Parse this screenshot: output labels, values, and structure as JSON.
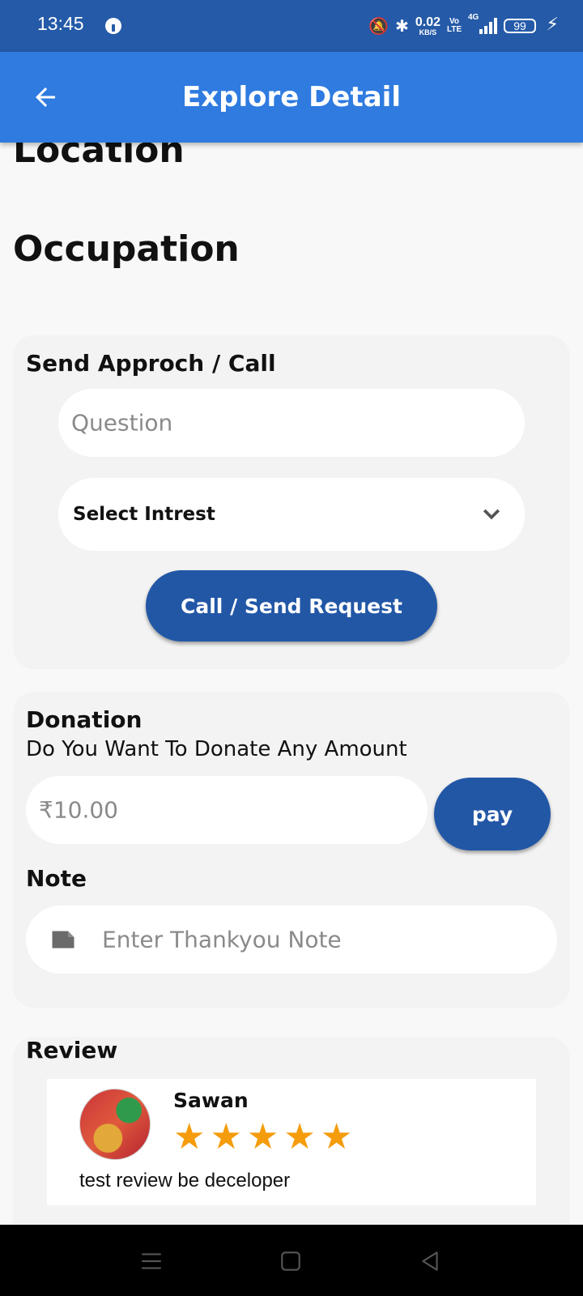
{
  "status_bar": {
    "time": "13:45",
    "net_speed_value": "0.02",
    "net_speed_unit": "KB/S",
    "volte": "Vo LTE",
    "network_type": "4G",
    "battery": "99"
  },
  "app_bar": {
    "title": "Explore Detail"
  },
  "profile": {
    "location_label": "Location",
    "occupation_label": "Occupation"
  },
  "approach": {
    "title": "Send Approch / Call",
    "question_placeholder": "Question",
    "interest_select": "Select Intrest",
    "button_label": "Call / Send Request"
  },
  "donation": {
    "title": "Donation",
    "subtitle": "Do You Want To Donate Any Amount",
    "amount_placeholder": "₹10.00",
    "pay_label": "pay",
    "note_title": "Note",
    "note_placeholder": "Enter Thankyou Note"
  },
  "review": {
    "title": "Review",
    "reviewer_name": "Sawan",
    "rating": 5,
    "text": "test review be deceloper"
  },
  "colors": {
    "status_bar": "#255aa8",
    "app_bar": "#2f7be0",
    "button": "#2257a6",
    "star": "#f59c0c"
  },
  "icons": [
    "back-arrow-icon",
    "chevron-down-icon",
    "note-icon",
    "star-icon",
    "menu-icon",
    "home-square-icon",
    "back-triangle-icon"
  ]
}
